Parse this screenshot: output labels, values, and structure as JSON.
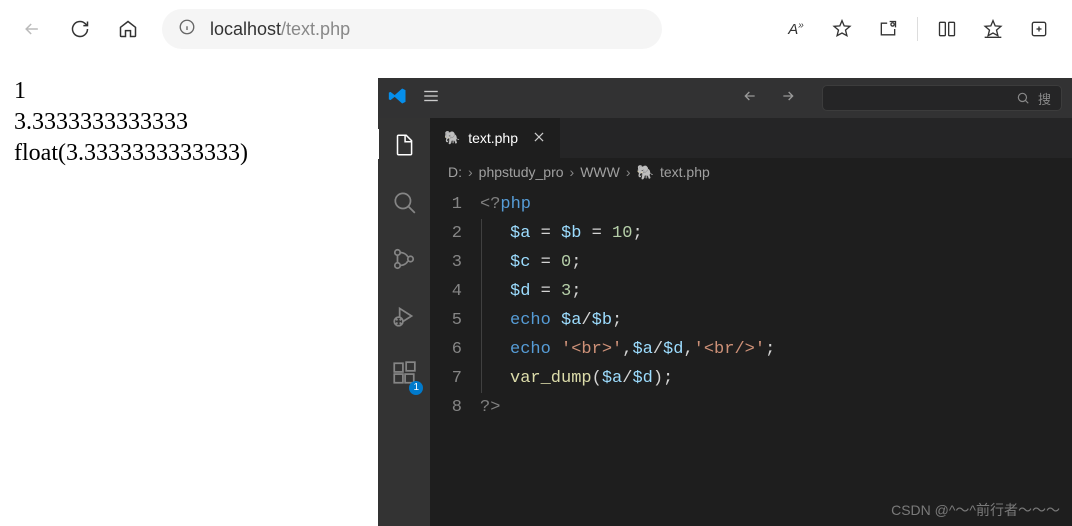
{
  "browser": {
    "url_host": "localhost",
    "url_path": "/text.php"
  },
  "page_output": {
    "line1": "1",
    "line2": "3.3333333333333",
    "line3": "float(3.3333333333333)"
  },
  "vscode": {
    "tab": {
      "filename": "text.php"
    },
    "breadcrumb": {
      "drive": "D:",
      "folder1": "phpstudy_pro",
      "folder2": "WWW",
      "file": "text.php"
    },
    "search_placeholder": "搜",
    "ext_badge": "1",
    "code": {
      "l1_open": "<?",
      "l1_php": "php",
      "l2_a": "$a",
      "l2_eq1": " = ",
      "l2_b": "$b",
      "l2_eq2": " = ",
      "l2_10": "10",
      "l2_semi": ";",
      "l3_c": "$c",
      "l3_eq": " = ",
      "l3_0": "0",
      "l3_semi": ";",
      "l4_d": "$d",
      "l4_eq": " = ",
      "l4_3": "3",
      "l4_semi": ";",
      "l5_echo": "echo ",
      "l5_a": "$a",
      "l5_sl": "/",
      "l5_b": "$b",
      "l5_semi": ";",
      "l6_echo": "echo ",
      "l6_s1": "'<br>'",
      "l6_c1": ",",
      "l6_a": "$a",
      "l6_sl": "/",
      "l6_d": "$d",
      "l6_c2": ",",
      "l6_s2": "'<br/>'",
      "l6_semi": ";",
      "l7_vd": "var_dump",
      "l7_op": "(",
      "l7_a": "$a",
      "l7_sl": "/",
      "l7_d": "$d",
      "l7_cp": ")",
      "l7_semi": ";",
      "l8_close": "?>"
    },
    "line_numbers": [
      "1",
      "2",
      "3",
      "4",
      "5",
      "6",
      "7",
      "8"
    ]
  },
  "watermark": "CSDN @^～^前行者～～～"
}
